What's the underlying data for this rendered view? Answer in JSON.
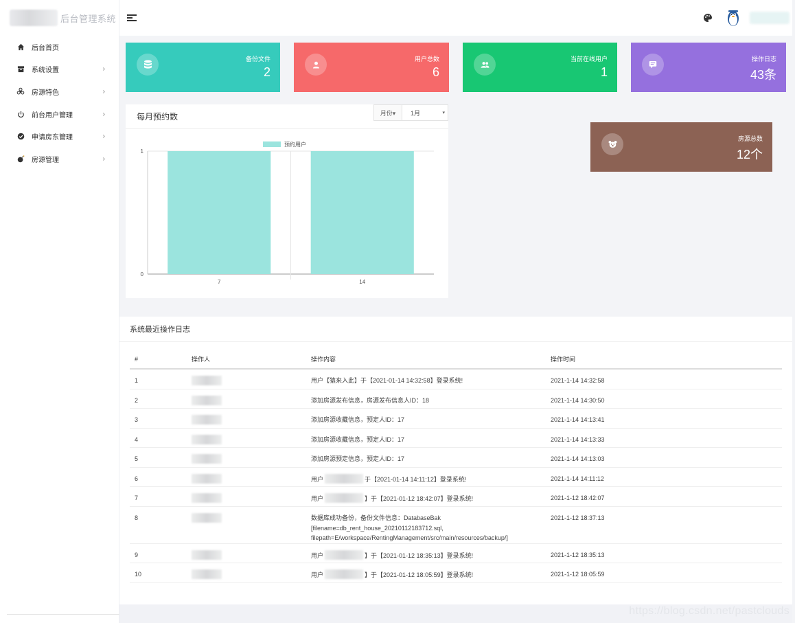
{
  "app": {
    "title": "后台管理系统"
  },
  "sidebar": {
    "items": [
      {
        "label": "后台首页",
        "icon": "home-icon",
        "arrow": ""
      },
      {
        "label": "系统设置",
        "icon": "archive-icon",
        "arrow": "›"
      },
      {
        "label": "房源特色",
        "icon": "biohazard-icon",
        "arrow": "›"
      },
      {
        "label": "前台用户管理",
        "icon": "power-icon",
        "arrow": "›"
      },
      {
        "label": "申请房东管理",
        "icon": "check-circle-icon",
        "arrow": "›"
      },
      {
        "label": "房源管理",
        "icon": "bomb-icon",
        "arrow": "›"
      }
    ]
  },
  "stats": [
    {
      "title": "备份文件",
      "value": "2",
      "color": "#36cbbc",
      "icon": "database-icon"
    },
    {
      "title": "用户总数",
      "value": "6",
      "color": "#f6696a",
      "icon": "user-icon"
    },
    {
      "title": "当前在线用户",
      "value": "1",
      "color": "#18c773",
      "icon": "users-icon"
    },
    {
      "title": "操作日志",
      "value": "43条",
      "color": "#9570de",
      "icon": "comment-icon"
    },
    {
      "title": "房源总数",
      "value": "12个",
      "color": "#8c6254",
      "icon": "bear-icon"
    }
  ],
  "chart_card": {
    "title": "每月预约数",
    "range_label": "月份▾",
    "selected_month": "1月",
    "caret": "▾"
  },
  "chart_data": {
    "type": "bar",
    "categories": [
      "7",
      "14"
    ],
    "series": [
      {
        "name": "预约用户",
        "values": [
          1,
          1
        ],
        "color": "#9be4de"
      }
    ],
    "ylim": [
      0,
      1
    ],
    "yticks": [
      "0",
      "1"
    ],
    "legend": "top-center",
    "grid": true
  },
  "log": {
    "title": "系统最近操作日志",
    "headers": [
      "#",
      "操作人",
      "操作内容",
      "操作时间"
    ],
    "rows": [
      {
        "num": "1",
        "content": "用户【猿来入此】于【2021-01-14 14:32:58】登录系统!",
        "time": "2021-1-14 14:32:58"
      },
      {
        "num": "2",
        "content": "添加房源发布信息，房源发布信息人ID：18",
        "time": "2021-1-14 14:30:50"
      },
      {
        "num": "3",
        "content": "添加房源收藏信息，预定人ID：17",
        "time": "2021-1-14 14:13:41"
      },
      {
        "num": "4",
        "content": "添加房源收藏信息，预定人ID：17",
        "time": "2021-1-14 14:13:33"
      },
      {
        "num": "5",
        "content": "添加房源预定信息，预定人ID：17",
        "time": "2021-1-14 14:13:03"
      },
      {
        "num": "6",
        "content_pre": "用户",
        "content_post": "于【2021-01-14 14:11:12】登录系统!",
        "time": "2021-1-14 14:11:12"
      },
      {
        "num": "7",
        "content_pre": "用户",
        "content_post": "】于【2021-01-12 18:42:07】登录系统!",
        "time": "2021-1-12 18:42:07"
      },
      {
        "num": "8",
        "content": "数据库成功备份，备份文件信息：DatabaseBak [filename=db_rent_house_20210112183712.sql, filepath=E/workspace/RentingManagement/src/main/resources/backup/]",
        "time": "2021-1-12 18:37:13"
      },
      {
        "num": "9",
        "content_pre": "用户",
        "content_post": "】于【2021-01-12 18:35:13】登录系统!",
        "time": "2021-1-12 18:35:13"
      },
      {
        "num": "10",
        "content_pre": "用户",
        "content_post": "】于【2021-01-12 18:05:59】登录系统!",
        "time": "2021-1-12 18:05:59"
      }
    ]
  },
  "watermark": "https://blog.csdn.net/pastclouds"
}
